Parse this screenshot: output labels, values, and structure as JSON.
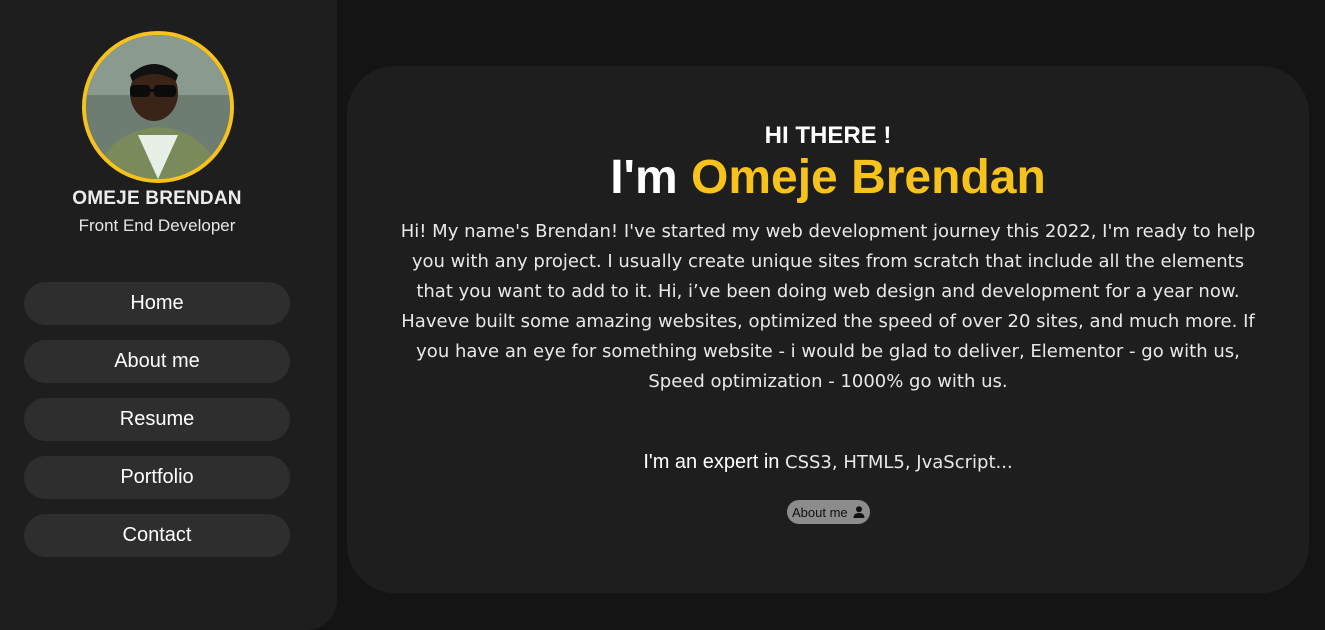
{
  "profile": {
    "name": "OMEJE BRENDAN",
    "role": "Front End Developer",
    "avatar_icon": "person-photo"
  },
  "nav": {
    "items": [
      {
        "label": "Home"
      },
      {
        "label": "About me"
      },
      {
        "label": "Resume"
      },
      {
        "label": "Portfolio"
      },
      {
        "label": "Contact"
      }
    ]
  },
  "hero": {
    "greeting": "HI THERE !",
    "intro": "I'm",
    "name_highlight": "Omeje Brendan",
    "bio": "Hi! My name's Brendan! I've started my web development journey this 2022, I'm ready to help you with any project. I usually create unique sites from scratch that include all the elements that you want to add to it. Hi, i’ve been doing web design and development for a year now. Haveve built some amazing websites, optimized the speed of over 20 sites, and much more. If you have an eye for something website - i would be glad to deliver, Elementor - go with us, Speed optimization - 1000% go with us.",
    "expert_prefix": "I'm an expert in",
    "expert_skills": "CSS3, HTML5, JvaScript...",
    "about_button": "About me",
    "about_button_icon": "user-icon"
  },
  "colors": {
    "accent": "#f7c21c",
    "background": "#141414",
    "panel": "#1e1e1e",
    "nav_item": "#2e2e2e"
  }
}
